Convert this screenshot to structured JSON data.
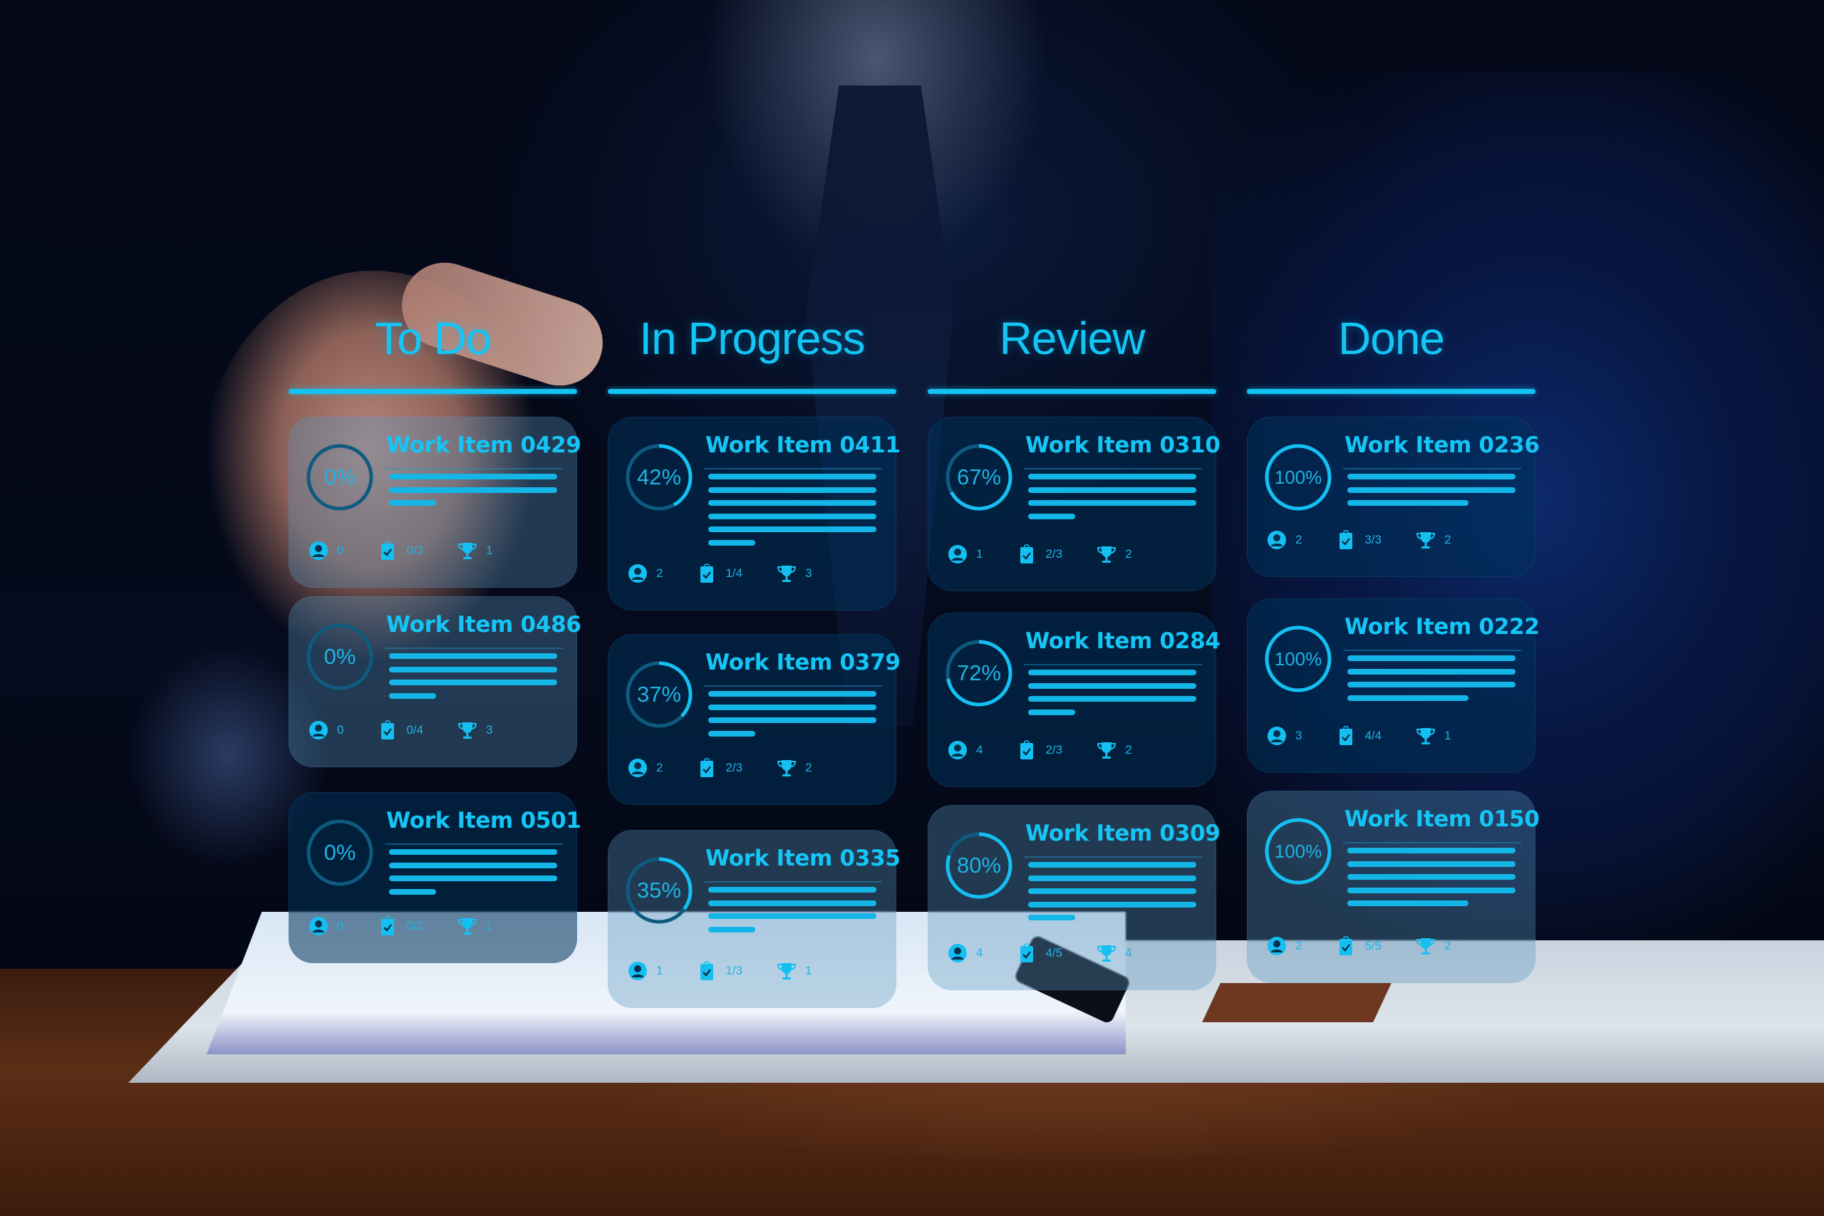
{
  "board": {
    "accent_color": "#14c5f6",
    "card_color": "#03324f",
    "columns": [
      {
        "title": "To Do",
        "cards": [
          {
            "title": "Work Item 0429",
            "progress_label": "0%",
            "progress": 0,
            "text_lines": 3,
            "assignees": "0",
            "checklist": "0/3",
            "awards": "1"
          },
          {
            "title": "Work Item 0486",
            "progress_label": "0%",
            "progress": 0,
            "text_lines": 4,
            "assignees": "0",
            "checklist": "0/4",
            "awards": "3"
          },
          {
            "title": "Work Item 0501",
            "progress_label": "0%",
            "progress": 0,
            "text_lines": 4,
            "assignees": "0",
            "checklist": "0/2",
            "awards": "1"
          }
        ]
      },
      {
        "title": "In Progress",
        "cards": [
          {
            "title": "Work Item 0411",
            "progress_label": "42%",
            "progress": 42,
            "text_lines": 6,
            "assignees": "2",
            "checklist": "1/4",
            "awards": "3"
          },
          {
            "title": "Work Item 0379",
            "progress_label": "37%",
            "progress": 37,
            "text_lines": 4,
            "assignees": "2",
            "checklist": "2/3",
            "awards": "2"
          },
          {
            "title": "Work Item 0335",
            "progress_label": "35%",
            "progress": 35,
            "text_lines": 4,
            "assignees": "1",
            "checklist": "1/3",
            "awards": "1"
          }
        ]
      },
      {
        "title": "Review",
        "cards": [
          {
            "title": "Work Item 0310",
            "progress_label": "67%",
            "progress": 67,
            "text_lines": 4,
            "assignees": "1",
            "checklist": "2/3",
            "awards": "2"
          },
          {
            "title": "Work Item 0284",
            "progress_label": "72%",
            "progress": 72,
            "text_lines": 4,
            "assignees": "4",
            "checklist": "2/3",
            "awards": "2"
          },
          {
            "title": "Work Item 0309",
            "progress_label": "80%",
            "progress": 80,
            "text_lines": 5,
            "assignees": "4",
            "checklist": "4/5",
            "awards": "4"
          }
        ]
      },
      {
        "title": "Done",
        "cards": [
          {
            "title": "Work Item 0236",
            "progress_label": "100%",
            "progress": 100,
            "text_lines": 3,
            "assignees": "2",
            "checklist": "3/3",
            "awards": "2"
          },
          {
            "title": "Work Item 0222",
            "progress_label": "100%",
            "progress": 100,
            "text_lines": 4,
            "assignees": "3",
            "checklist": "4/4",
            "awards": "1"
          },
          {
            "title": "Work Item 0150",
            "progress_label": "100%",
            "progress": 100,
            "text_lines": 5,
            "assignees": "2",
            "checklist": "5/5",
            "awards": "2"
          }
        ]
      }
    ],
    "icons": {
      "assignees": "user-avatar-icon",
      "checklist": "clipboard-check-icon",
      "awards": "trophy-icon"
    }
  }
}
